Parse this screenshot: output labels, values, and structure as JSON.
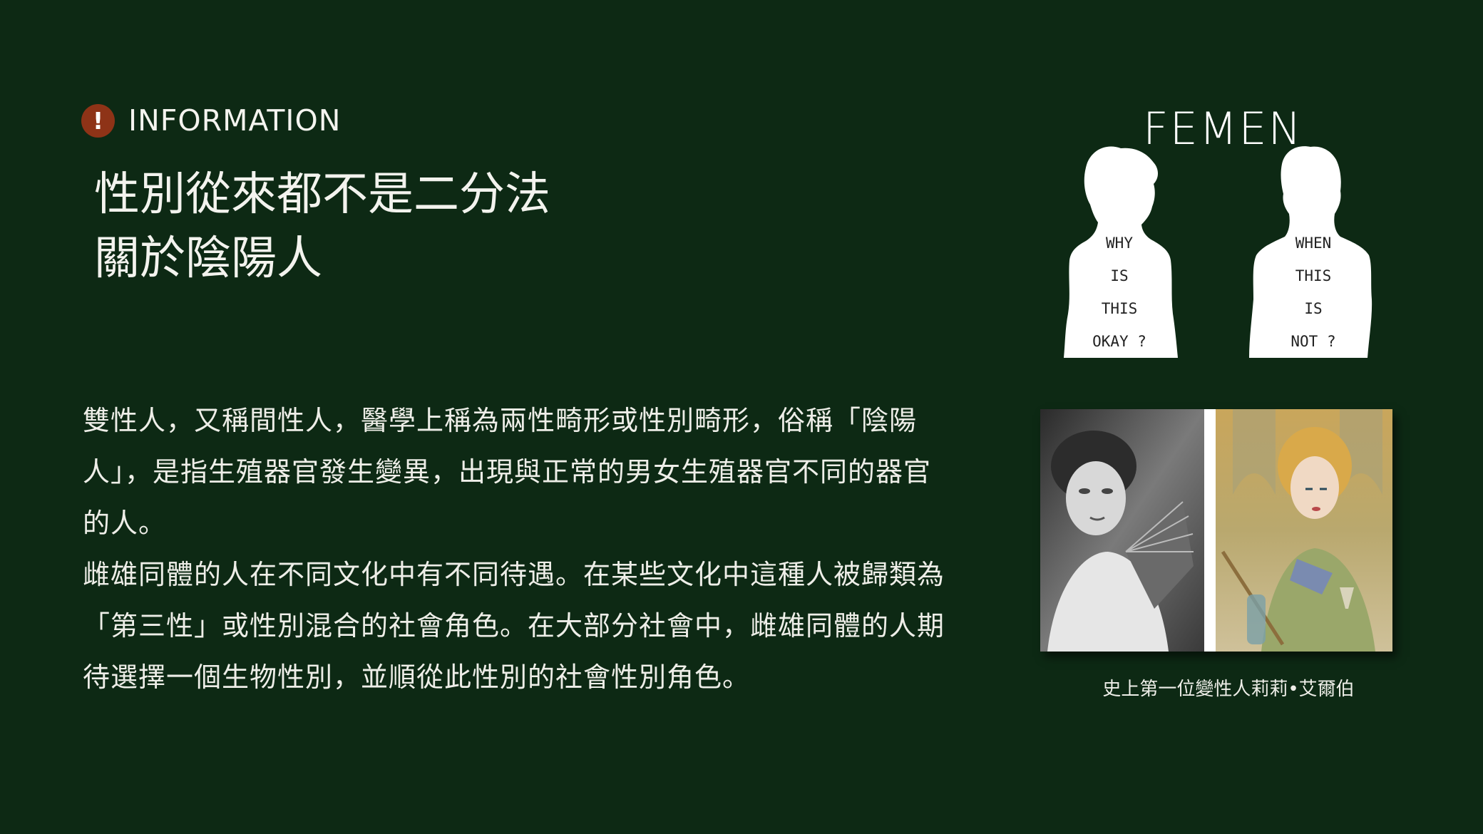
{
  "header": {
    "icon": "exclamation-icon",
    "icon_glyph": "!",
    "icon_color": "#8e3317",
    "label": "INFORMATION"
  },
  "title": {
    "line1": "性別從來都不是二分法",
    "line2": "關於陰陽人"
  },
  "body": {
    "paragraph1": "雙性人，又稱間性人，醫學上稱為兩性畸形或性別畸形，俗稱「陰陽人」，是指生殖器官發生變異，出現與正常的男女生殖器官不同的器官的人。",
    "paragraph2": "雌雄同體的人在不同文化中有不同待遇。在某些文化中這種人被歸類為「第三性」或性別混合的社會角色。在大部分社會中，雌雄同體的人期待選擇一個生物性別，並順從此性別的社會性別角色。"
  },
  "graphic": {
    "title": "FEMEN",
    "female_words": [
      "WHY",
      "IS",
      "THIS",
      "OKAY ?"
    ],
    "male_words": [
      "WHEN",
      "THIS",
      "IS",
      "NOT ?"
    ]
  },
  "photo": {
    "caption": "史上第一位變性人莉莉•艾爾伯"
  },
  "colors": {
    "background": "#0d2914",
    "text": "#f2f2ee",
    "accent": "#8e3317"
  }
}
